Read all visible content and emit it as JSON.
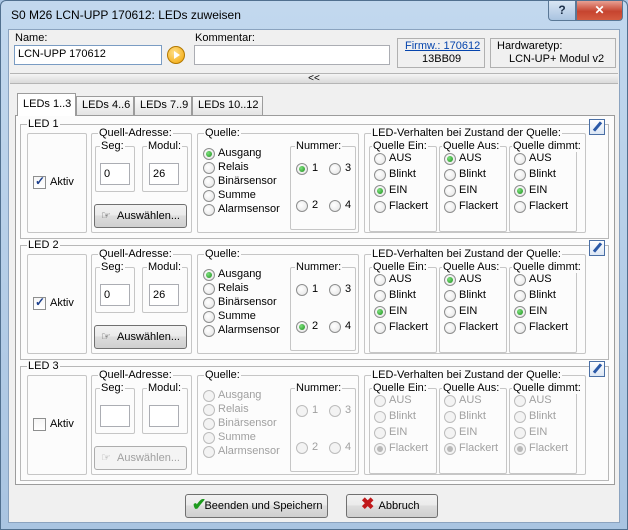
{
  "window": {
    "title": "S0 M26 LCN-UPP 170612: LEDs zuweisen",
    "help_label": "?",
    "close_label": "✕"
  },
  "header": {
    "name_label": "Name:",
    "name_value": "LCN-UPP 170612",
    "comment_label": "Kommentar:",
    "comment_value": "",
    "firmware_label": "Firmw.: 170612",
    "firmware_value": "13BB09",
    "hwtype_label": "Hardwaretyp:",
    "hwtype_value": "LCN-UP+ Modul v2"
  },
  "collapse_label": "<<",
  "tabs": [
    {
      "label": "LEDs 1..3",
      "active": true
    },
    {
      "label": "LEDs 4..6",
      "active": false
    },
    {
      "label": "LEDs 7..9",
      "active": false
    },
    {
      "label": "LEDs 10..12",
      "active": false
    }
  ],
  "labels": {
    "aktiv": "Aktiv",
    "quell_adresse": "Quell-Adresse:",
    "seg": "Seg:",
    "modul": "Modul:",
    "auswaehlen": "Auswählen...",
    "quelle": "Quelle:",
    "nummer": "Nummer:",
    "verhalten": "LED-Verhalten bei Zustand der Quelle:",
    "quelle_ein": "Quelle Ein:",
    "quelle_aus": "Quelle Aus:",
    "quelle_dimmt": "Quelle dimmt:"
  },
  "source_options": [
    "Ausgang",
    "Relais",
    "Binärsensor",
    "Summe",
    "Alarmsensor"
  ],
  "number_options": [
    "1",
    "3",
    "2",
    "4"
  ],
  "behavior_options": [
    "AUS",
    "Blinkt",
    "EIN",
    "Flackert"
  ],
  "leds": [
    {
      "title": "LED 1",
      "aktiv": true,
      "seg": "0",
      "modul": "26",
      "source": "Ausgang",
      "number": "1",
      "ein": "EIN",
      "aus": "AUS",
      "dimmt": "EIN",
      "enabled": true
    },
    {
      "title": "LED 2",
      "aktiv": true,
      "seg": "0",
      "modul": "26",
      "source": "Ausgang",
      "number": "2",
      "ein": "EIN",
      "aus": "AUS",
      "dimmt": "EIN",
      "enabled": true
    },
    {
      "title": "LED 3",
      "aktiv": false,
      "seg": "",
      "modul": "",
      "source": "",
      "number": "",
      "ein": "Flackert",
      "aus": "Flackert",
      "dimmt": "Flackert",
      "enabled": false
    }
  ],
  "footer": {
    "save_label": "Beenden und Speichern",
    "cancel_label": "Abbruch"
  },
  "colors": {
    "active_radio": "#1a8f1a",
    "cancel_icon": "#c0181a",
    "save_icon": "#1e9b1e",
    "arrow_icon": "#f1a300"
  }
}
